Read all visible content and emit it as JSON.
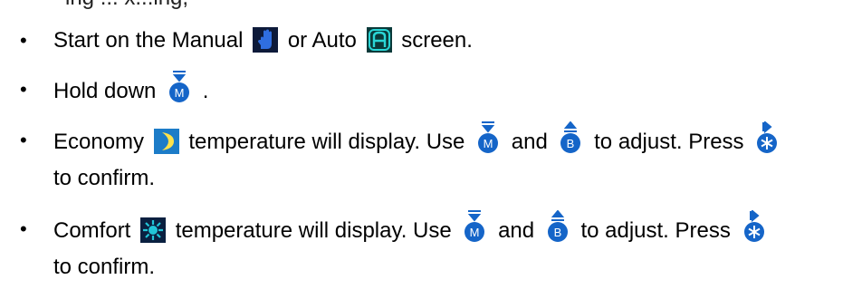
{
  "partial_heading": "ing ... x...ing,",
  "items": [
    {
      "before_icon_1": "Start on the Manual",
      "icon_1": "hand-icon",
      "between": "or Auto",
      "icon_2": "auto-a-icon",
      "after": "screen."
    },
    {
      "before_icon_1": "Hold down",
      "icon_1": "m-down-button-icon",
      "after": "."
    },
    {
      "before_icon_1": "Economy",
      "icon_1": "crescent-moon-icon",
      "mid_1": "temperature will display. Use",
      "icon_2": "m-down-button-icon",
      "mid_2": "and",
      "icon_3": "b-up-button-icon",
      "mid_3": "to adjust. Press",
      "icon_4": "snowflake-button-icon",
      "line2": "to confirm."
    },
    {
      "before_icon_1": "Comfort",
      "icon_1": "sun-icon",
      "mid_1": "temperature will display. Use",
      "icon_2": "m-down-button-icon",
      "mid_2": "and",
      "icon_3": "b-up-button-icon",
      "mid_3": "to adjust. Press",
      "icon_4": "snowflake-button-icon",
      "line2": "to confirm."
    }
  ],
  "bullet_char": "•",
  "colors": {
    "icon_blue": "#1565c8",
    "icon_dark": "#0a2a52",
    "hand_bg": "#0d1a3a",
    "hand_fg": "#2f6ee0",
    "auto_bg": "#0a3a3a",
    "auto_fg": "#2ad6d6",
    "moon_bg": "#1c7cc8",
    "moon_fg": "#ffe24a",
    "sun_bg": "#0a2040",
    "sun_fg": "#22c6d8"
  }
}
